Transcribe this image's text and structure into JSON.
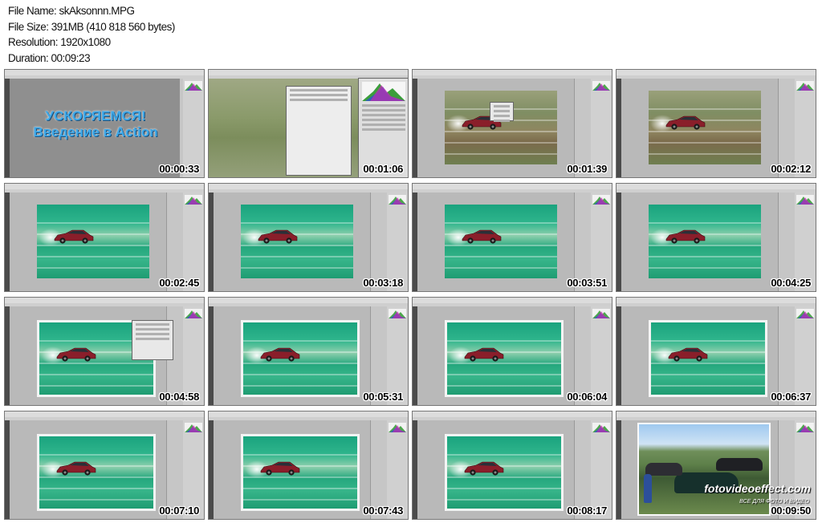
{
  "header": {
    "file_name": "File Name: skAksonnn.MPG",
    "file_size": "File Size: 391MB (410 818 560 bytes)",
    "resolution": "Resolution: 1920x1080",
    "duration": "Duration: 00:09:23"
  },
  "title_card": {
    "line1": "УСКОРЯЕМСЯ!",
    "line2": "Введение в Action"
  },
  "watermark": {
    "site": "fotovideoeffect.com",
    "tagline": "ВСЕ ДЛЯ ФОТО И ВИДЕО"
  },
  "thumbnails": [
    {
      "time": "00:00:33",
      "kind": "title"
    },
    {
      "time": "00:01:06",
      "kind": "actions-panel"
    },
    {
      "time": "00:01:39",
      "kind": "car-natural-dialog"
    },
    {
      "time": "00:02:12",
      "kind": "car-natural"
    },
    {
      "time": "00:02:45",
      "kind": "car-green"
    },
    {
      "time": "00:03:18",
      "kind": "car-green"
    },
    {
      "time": "00:03:51",
      "kind": "car-green"
    },
    {
      "time": "00:04:25",
      "kind": "car-green"
    },
    {
      "time": "00:04:58",
      "kind": "car-green-border-dialog"
    },
    {
      "time": "00:05:31",
      "kind": "car-green-border"
    },
    {
      "time": "00:06:04",
      "kind": "car-green-border"
    },
    {
      "time": "00:06:37",
      "kind": "car-green-border"
    },
    {
      "time": "00:07:10",
      "kind": "car-green-border"
    },
    {
      "time": "00:07:43",
      "kind": "car-green-border"
    },
    {
      "time": "00:08:17",
      "kind": "car-green-border"
    },
    {
      "time": "00:09:50",
      "kind": "parking-lot"
    }
  ],
  "colors": {
    "title_text": "#3ea8e8",
    "ps_background": "#b9b9b9",
    "timestamp": "#000000"
  }
}
